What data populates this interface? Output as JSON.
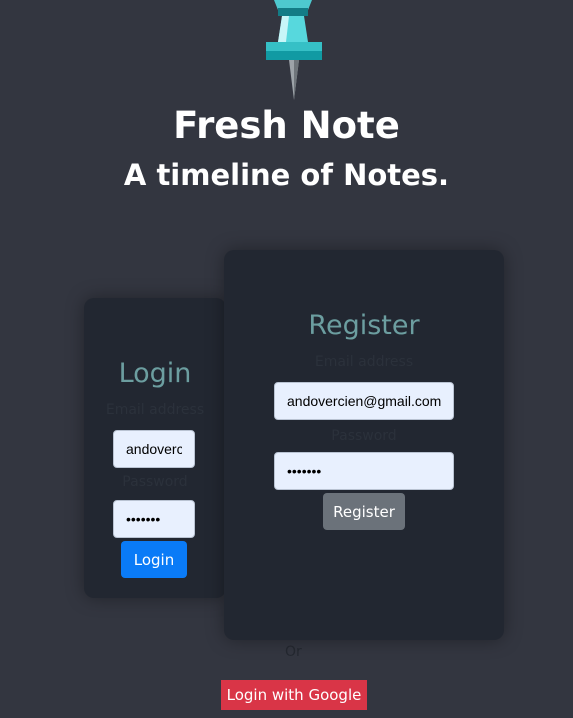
{
  "header": {
    "logo_icon": "pushpin-icon",
    "title": "Fresh Note",
    "subtitle": "A timeline of Notes."
  },
  "login": {
    "heading": "Login",
    "email_label": "Email address",
    "email_value": "andovercien@gmail.com",
    "password_label": "Password",
    "password_value": "1234567",
    "button_label": "Login"
  },
  "register": {
    "heading": "Register",
    "email_label": "Email address",
    "email_value": "andovercien@gmail.com",
    "password_label": "Password",
    "password_value": "1234567",
    "button_label": "Register"
  },
  "or_text": "Or",
  "google_button_label": "Login with Google",
  "colors": {
    "background": "#333640",
    "card": "#222731",
    "heading_accent": "#6c9ea0",
    "login_button": "#0a7bf7",
    "register_button": "#6b727a",
    "google_button": "#d93547"
  }
}
